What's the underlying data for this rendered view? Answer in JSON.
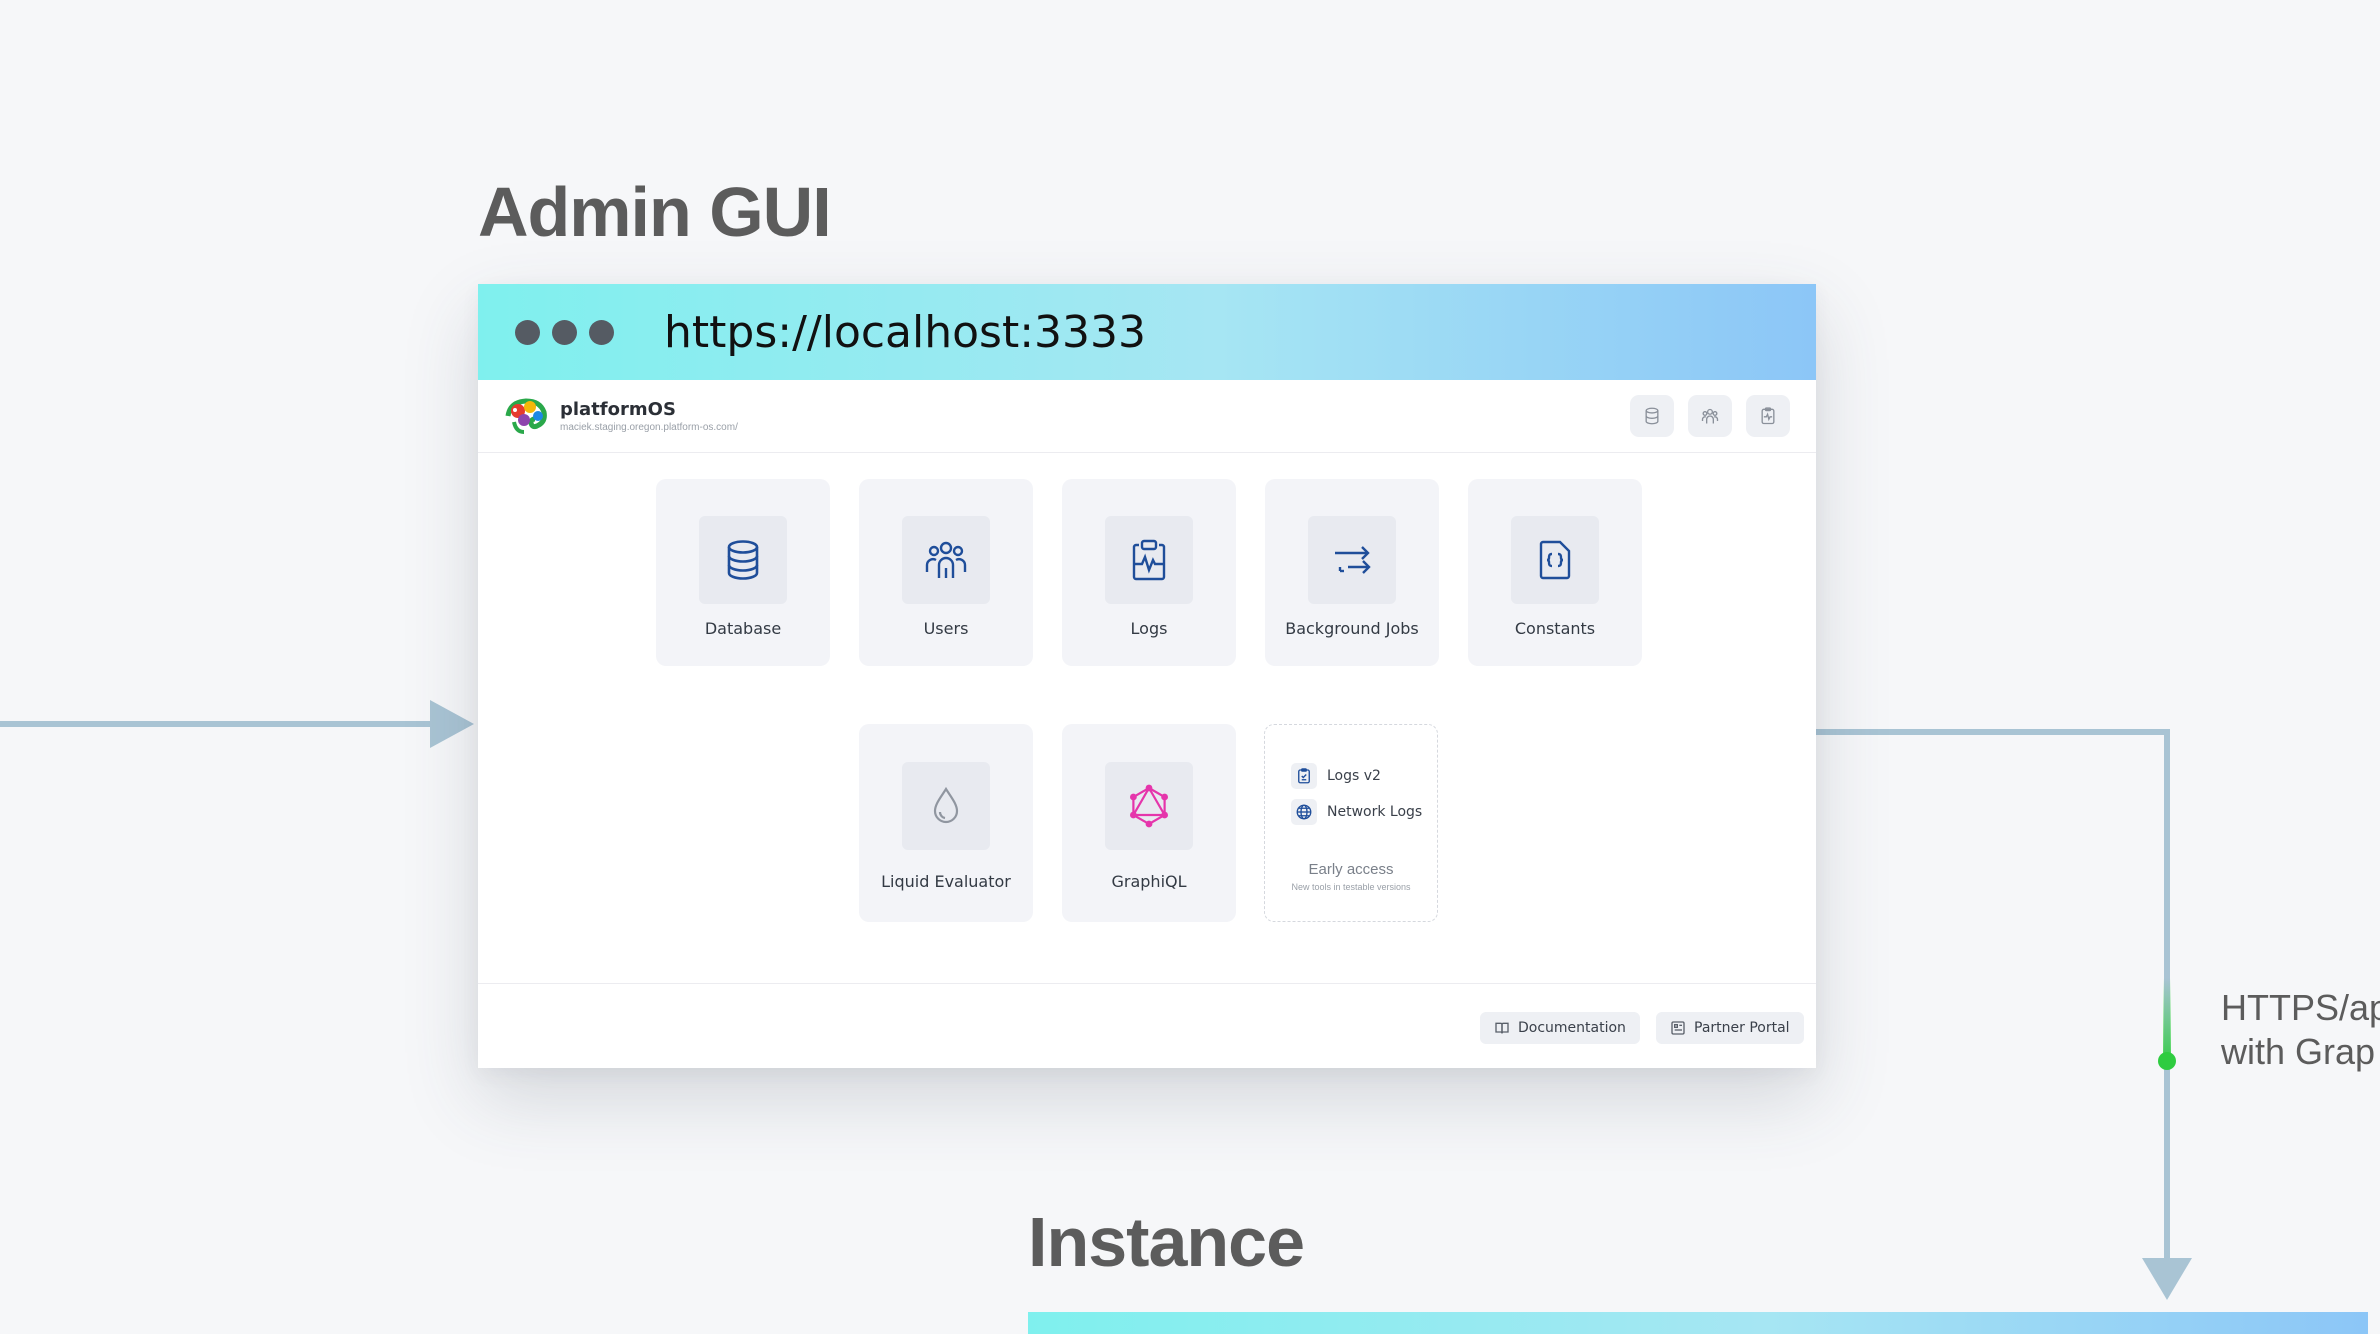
{
  "diagram": {
    "admin_title": "Admin GUI",
    "instance_title": "Instance",
    "edge_label_line1": "HTTPS/ap",
    "edge_label_line2": "with Grap"
  },
  "browser": {
    "url": "https://localhost:3333"
  },
  "app": {
    "brand_name": "platformOS",
    "host": "maciek.staging.oregon.platform-os.com/",
    "header_actions": [
      "database-icon",
      "users-icon",
      "logs-icon"
    ]
  },
  "tiles": [
    {
      "label": "Database",
      "icon": "database-icon"
    },
    {
      "label": "Users",
      "icon": "users-icon"
    },
    {
      "label": "Logs",
      "icon": "logs-icon"
    },
    {
      "label": "Background Jobs",
      "icon": "background-jobs-icon"
    },
    {
      "label": "Constants",
      "icon": "constants-icon"
    },
    {
      "label": "Liquid Evaluator",
      "icon": "liquid-drop-icon"
    },
    {
      "label": "GraphiQL",
      "icon": "graphql-icon"
    }
  ],
  "early_access": {
    "items": [
      {
        "label": "Logs v2",
        "icon": "logs-v2-icon"
      },
      {
        "label": "Network Logs",
        "icon": "globe-icon"
      }
    ],
    "title": "Early access",
    "subtitle": "New tools in testable versions"
  },
  "footer": {
    "documentation": "Documentation",
    "partner_portal": "Partner Portal"
  },
  "colors": {
    "accent_start": "#7ff0ee",
    "accent_end": "#8cc6f7",
    "icon_blue": "#1f4e9a",
    "graphql_pink": "#e535ab",
    "connector": "#a9c4d4",
    "status_green": "#2ecc40"
  }
}
